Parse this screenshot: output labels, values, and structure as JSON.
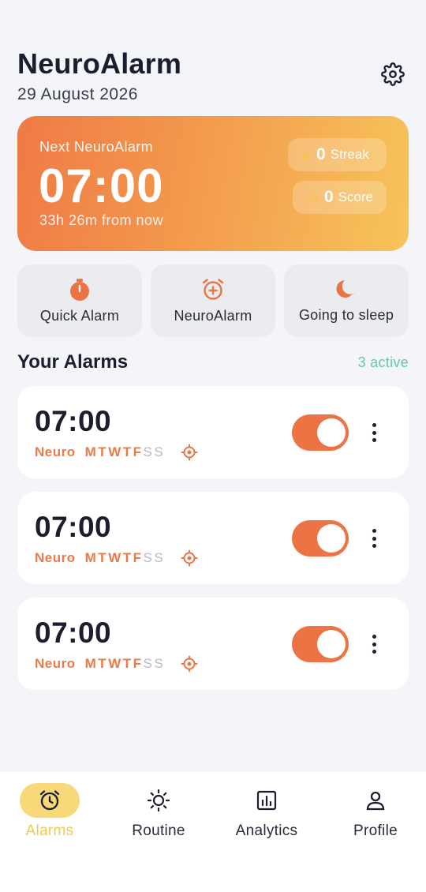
{
  "header": {
    "title": "NeuroAlarm",
    "date": "29 August 2026"
  },
  "hero": {
    "label": "Next NeuroAlarm",
    "time": "07:00",
    "subtitle": "33h 26m from now",
    "streak": {
      "value": "0",
      "label": "Streak"
    },
    "score": {
      "value": "0",
      "label": "Score"
    }
  },
  "actions": [
    {
      "label": "Quick Alarm",
      "icon": "stopwatch-icon"
    },
    {
      "label": "NeuroAlarm",
      "icon": "alarm-plus-icon"
    },
    {
      "label": "Going to sleep",
      "icon": "moon-icon"
    }
  ],
  "alarms_section": {
    "title": "Your Alarms",
    "count": "3 active"
  },
  "alarms": [
    {
      "time": "07:00",
      "type": "Neuro",
      "days_on": [
        "M",
        "T",
        "W",
        "T",
        "F"
      ],
      "days_off": [
        "S",
        "S"
      ],
      "enabled": true
    },
    {
      "time": "07:00",
      "type": "Neuro",
      "days_on": [
        "M",
        "T",
        "W",
        "T",
        "F"
      ],
      "days_off": [
        "S",
        "S"
      ],
      "enabled": true
    },
    {
      "time": "07:00",
      "type": "Neuro",
      "days_on": [
        "M",
        "T",
        "W",
        "T",
        "F"
      ],
      "days_off": [
        "S",
        "S"
      ],
      "enabled": true
    }
  ],
  "nav": [
    {
      "label": "Alarms",
      "icon": "alarm-clock-icon",
      "active": true
    },
    {
      "label": "Routine",
      "icon": "sun-icon",
      "active": false
    },
    {
      "label": "Analytics",
      "icon": "chart-icon",
      "active": false
    },
    {
      "label": "Profile",
      "icon": "person-icon",
      "active": false
    }
  ],
  "colors": {
    "accent": "#ec7344",
    "active_green": "#5ccba7",
    "nav_active": "#f2c94c"
  }
}
